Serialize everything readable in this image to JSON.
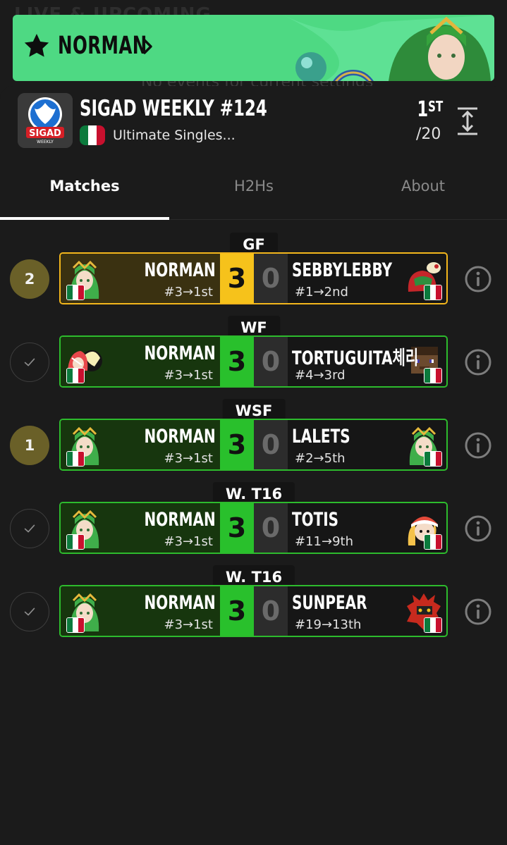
{
  "background": {
    "ghost_title": "LIVE & UPCOMING",
    "ghost_msg": "No events for current settings"
  },
  "player_banner": {
    "name": "NORMAN",
    "star_icon": "star-icon",
    "chevron_icon": "chevron-right-icon",
    "color": "#4ed983"
  },
  "tournament": {
    "logo_text": "SIGAD",
    "logo_sub": "WEEKLY",
    "title": "SIGAD WEEKLY #124",
    "subtitle": "Ultimate Singles...",
    "placing": "1",
    "placing_suffix": "ST",
    "entrants": "/20",
    "flag": "mexico-flag-icon",
    "expand_icon": "expand-vertical-icon"
  },
  "tabs": [
    {
      "label": "Matches",
      "active": true
    },
    {
      "label": "H2Hs",
      "active": false
    },
    {
      "label": "About",
      "active": false
    }
  ],
  "matches": [
    {
      "badge": "2",
      "badge_type": "number",
      "round": "GF",
      "border": "gold",
      "p1": {
        "name": "NORMAN",
        "seed": "#3→1st",
        "character": "palutena"
      },
      "p2": {
        "name": "SEBBYLEBBY",
        "seed": "#1→2nd",
        "character": "samus"
      },
      "score1": "3",
      "score2": "0"
    },
    {
      "badge": "",
      "badge_type": "check",
      "round": "WF",
      "border": "green",
      "p1": {
        "name": "NORMAN",
        "seed": "#3→1st",
        "character": "pyra-mythra"
      },
      "p2": {
        "name": "TORTUGUITA체리",
        "seed": "#4→3rd",
        "character": "steve"
      },
      "score1": "3",
      "score2": "0"
    },
    {
      "badge": "1",
      "badge_type": "number",
      "round": "WSF",
      "border": "green",
      "p1": {
        "name": "NORMAN",
        "seed": "#3→1st",
        "character": "palutena"
      },
      "p2": {
        "name": "LALETS",
        "seed": "#2→5th",
        "character": "palutena"
      },
      "score1": "3",
      "score2": "0"
    },
    {
      "badge": "",
      "badge_type": "check",
      "round": "W. T16",
      "border": "green",
      "p1": {
        "name": "NORMAN",
        "seed": "#3→1st",
        "character": "palutena"
      },
      "p2": {
        "name": "TOTIS",
        "seed": "#11→9th",
        "character": "min-min"
      },
      "score1": "3",
      "score2": "0"
    },
    {
      "badge": "",
      "badge_type": "check",
      "round": "W. T16",
      "border": "green",
      "p1": {
        "name": "NORMAN",
        "seed": "#3→1st",
        "character": "palutena"
      },
      "p2": {
        "name": "SUNPEAR",
        "seed": "#19→13th",
        "character": "incineroar"
      },
      "score1": "3",
      "score2": "0"
    }
  ],
  "colors": {
    "gold": "#f6c21b",
    "green": "#29c02c",
    "badge_number": "#6a6028"
  }
}
